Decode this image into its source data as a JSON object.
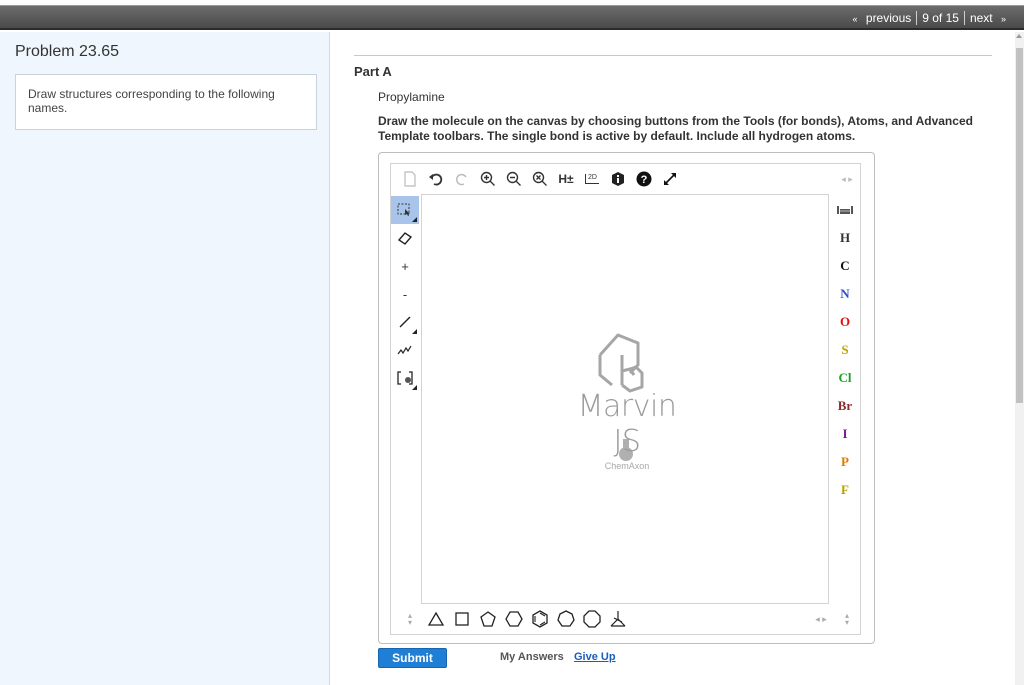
{
  "nav": {
    "previous": "previous",
    "position": "9 of 15",
    "next": "next",
    "lq": "«",
    "rq": "»"
  },
  "problem": {
    "title": "Problem 23.65",
    "question": "Draw structures corresponding to the following names."
  },
  "part": {
    "label": "Part A",
    "compound": "Propylamine",
    "instructions": "Draw the molecule on the canvas by choosing buttons from the Tools (for bonds), Atoms, and Advanced Template toolbars. The single bond is active by default. Include all hydrogen atoms."
  },
  "editor": {
    "brand": "Marvin JS",
    "vendor": "ChemAxon",
    "top_tools": [
      "new-document",
      "undo",
      "redo",
      "zoom-in",
      "zoom-out",
      "zoom-reset",
      "hydrogens",
      "2d-clean",
      "info",
      "help",
      "fullscreen"
    ],
    "hydrogen_label": "H±",
    "clean_label": "2D",
    "plus_label": "+",
    "minus_label": "-",
    "atoms": [
      {
        "symbol": "H",
        "color": "#333333"
      },
      {
        "symbol": "C",
        "color": "#111111"
      },
      {
        "symbol": "N",
        "color": "#3050c8"
      },
      {
        "symbol": "O",
        "color": "#e01010"
      },
      {
        "symbol": "S",
        "color": "#b8a800"
      },
      {
        "symbol": "Cl",
        "color": "#1fa01f"
      },
      {
        "symbol": "Br",
        "color": "#8a2a2a"
      },
      {
        "symbol": "I",
        "color": "#7a1a9a"
      },
      {
        "symbol": "P",
        "color": "#e07a00"
      },
      {
        "symbol": "F",
        "color": "#b8a000"
      }
    ]
  },
  "actions": {
    "submit": "Submit",
    "my_answers": "My Answers",
    "give_up": "Give Up"
  },
  "colors": {
    "accent": "#1e7fd4",
    "topbar": "#555555",
    "left_panel": "#f0f6fd"
  }
}
